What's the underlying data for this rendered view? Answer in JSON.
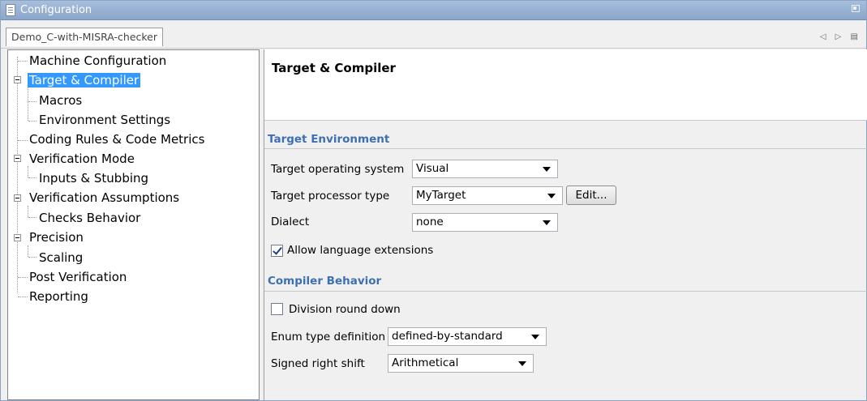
{
  "window": {
    "title": "Configuration",
    "tab_label": "Demo_C-with-MISRA-checker",
    "tab_nav": "◁ ▷ ▤"
  },
  "tree": {
    "items": [
      {
        "label": "Machine Configuration"
      },
      {
        "label": "Target & Compiler"
      },
      {
        "label": "Macros"
      },
      {
        "label": "Environment Settings"
      },
      {
        "label": "Coding Rules & Code Metrics"
      },
      {
        "label": "Verification Mode"
      },
      {
        "label": "Inputs & Stubbing"
      },
      {
        "label": "Verification Assumptions"
      },
      {
        "label": "Checks Behavior"
      },
      {
        "label": "Precision"
      },
      {
        "label": "Scaling"
      },
      {
        "label": "Post Verification"
      },
      {
        "label": "Reporting"
      }
    ],
    "selected": "Target & Compiler"
  },
  "panel": {
    "title": "Target & Compiler",
    "target_env": {
      "heading": "Target Environment",
      "os_label": "Target operating system",
      "os_value": "Visual",
      "proc_label": "Target processor type",
      "proc_value": "MyTarget",
      "edit_label": "Edit...",
      "dialect_label": "Dialect",
      "dialect_value": "none",
      "lang_ext_label": "Allow language extensions",
      "lang_ext_checked": true
    },
    "compiler": {
      "heading": "Compiler Behavior",
      "div_label": "Division round down",
      "div_checked": false,
      "enum_label": "Enum type definition",
      "enum_value": "defined-by-standard",
      "shift_label": "Signed right shift",
      "shift_value": "Arithmetical"
    }
  },
  "colors": {
    "titlebar": "#8ba5c9",
    "selection": "#3399ff",
    "section_heading": "#3e6fb3"
  }
}
